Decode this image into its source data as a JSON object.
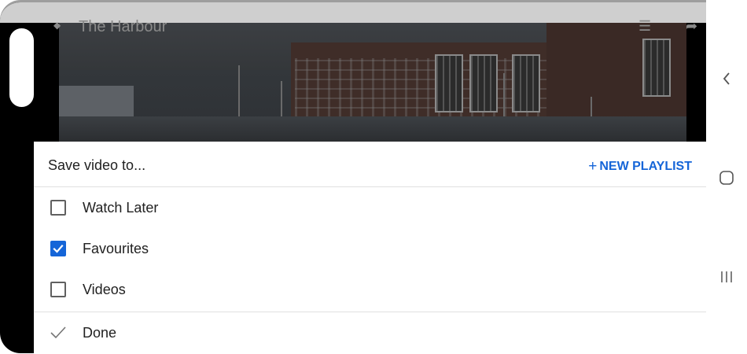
{
  "video": {
    "title": "The Harbour"
  },
  "sheet": {
    "title": "Save video to...",
    "new_playlist_plus": "+",
    "new_playlist_label": "NEW PLAYLIST",
    "playlists": [
      {
        "label": "Watch Later",
        "checked": false
      },
      {
        "label": "Favourites",
        "checked": true
      },
      {
        "label": "Videos",
        "checked": false
      }
    ],
    "done_label": "Done"
  },
  "navigation": {
    "back": "back-chevron-icon",
    "home": "home-icon",
    "recents": "recents-icon"
  },
  "colors": {
    "accent": "#1565d8",
    "text": "#212121",
    "divider": "#e0e0e0"
  }
}
